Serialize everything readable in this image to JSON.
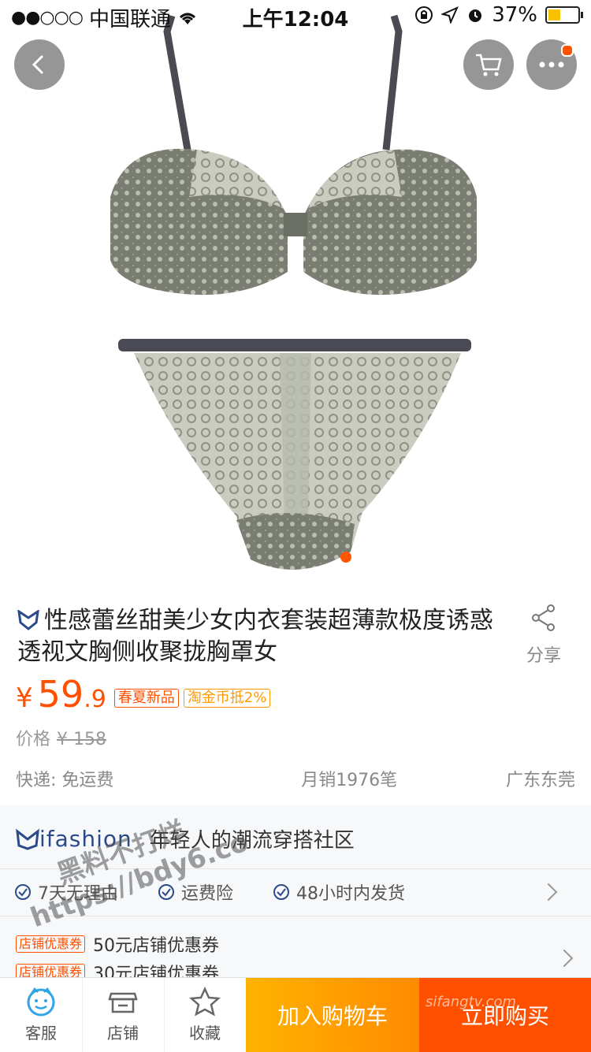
{
  "status_bar": {
    "signal": "●●○○○",
    "carrier": "中国联通",
    "time": "上午12:04",
    "battery": "37%"
  },
  "product": {
    "title": "性感蕾丝甜美少女内衣套装超薄款极度诱惑透视文胸侧收聚拢胸罩女",
    "share_label": "分享",
    "currency": "¥",
    "price_int": "59",
    "price_dec": ".9",
    "tags": [
      "春夏新品",
      "淘金币抵2%"
    ],
    "orig_label": "价格",
    "orig_price": "¥ 158",
    "shipping": "快递: 免运费",
    "monthly_sales": "月销1976笔",
    "location": "广东东莞"
  },
  "shop": {
    "logo": "ifashion",
    "slogan": "年轻人的潮流穿搭社区",
    "services": [
      "7天无理由",
      "运费险",
      "48小时内发货"
    ],
    "coupons": [
      {
        "tag": "店铺优惠券",
        "text": "50元店铺优惠券"
      },
      {
        "tag": "店铺优惠券",
        "text": "30元店铺优惠券"
      }
    ]
  },
  "watermark": {
    "line1": "黑料不打烊",
    "line2": "https://bdy6.co",
    "corner": "sifangtv.com"
  },
  "bottom_bar": {
    "service": "客服",
    "store": "店铺",
    "favorite": "收藏",
    "add_cart": "加入购物车",
    "buy_now": "立即购买"
  },
  "colors": {
    "accent": "#ff5000",
    "cart_btn": "#ff9900",
    "tag_new": "#ff5000",
    "tag_coin": "#ff9900",
    "brand_blue": "#2b4a8a"
  }
}
